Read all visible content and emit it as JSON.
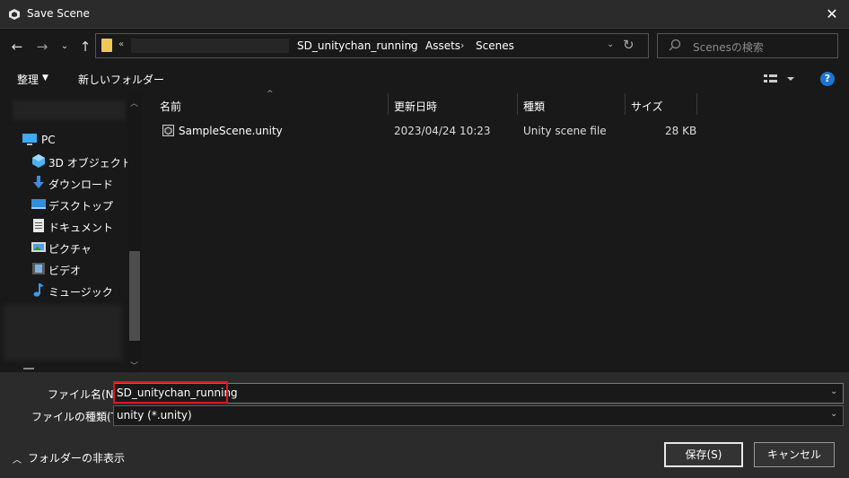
{
  "window": {
    "title": "Save Scene",
    "close_glyph": "✕"
  },
  "nav": {
    "back_glyph": "←",
    "forward_glyph": "→",
    "recent_glyph": "⌄",
    "up_glyph": "↑",
    "refresh_glyph": "↻"
  },
  "address": {
    "overflow": "«",
    "crumbs": [
      "SD_unitychan_running",
      "Assets",
      "Scenes"
    ],
    "separator": "›",
    "dropdown_glyph": "⌄"
  },
  "search": {
    "placeholder": "Scenesの検索"
  },
  "toolbar": {
    "organize_label": "整理",
    "organize_dd": "▼",
    "new_folder_label": "新しいフォルダー",
    "help_glyph": "?"
  },
  "sidebar": {
    "items": [
      {
        "label": "PC",
        "icon": "pc-icon"
      },
      {
        "label": "3D オブジェクト",
        "icon": "3d-objects-icon"
      },
      {
        "label": "ダウンロード",
        "icon": "download-icon"
      },
      {
        "label": "デスクトップ",
        "icon": "desktop-icon"
      },
      {
        "label": "ドキュメント",
        "icon": "document-icon"
      },
      {
        "label": "ピクチャ",
        "icon": "picture-icon"
      },
      {
        "label": "ビデオ",
        "icon": "video-icon"
      },
      {
        "label": "ミュージック",
        "icon": "music-icon"
      }
    ],
    "scroll_up": "︿",
    "scroll_down": "﹀"
  },
  "filelist": {
    "columns": [
      "名前",
      "更新日時",
      "種類",
      "サイズ"
    ],
    "sort_glyph": "^",
    "rows": [
      {
        "name": "SampleScene.unity",
        "date": "2023/04/24 10:23",
        "type": "Unity scene file",
        "size": "28 KB"
      }
    ]
  },
  "form": {
    "filename_label": "ファイル名(N):",
    "filename_value": "SD_unitychan_running",
    "filetype_label": "ファイルの種類(T):",
    "filetype_value": "unity (*.unity)",
    "dropdown_glyph": "⌄"
  },
  "footer": {
    "hide_folders_chevron": "︿",
    "hide_folders_label": "フォルダーの非表示",
    "save_label": "保存(S)",
    "cancel_label": "キャンセル"
  },
  "colors": {
    "accent_blue": "#1e74d4",
    "highlight_red": "#e0141e",
    "folder_yellow": "#f0c75a"
  }
}
